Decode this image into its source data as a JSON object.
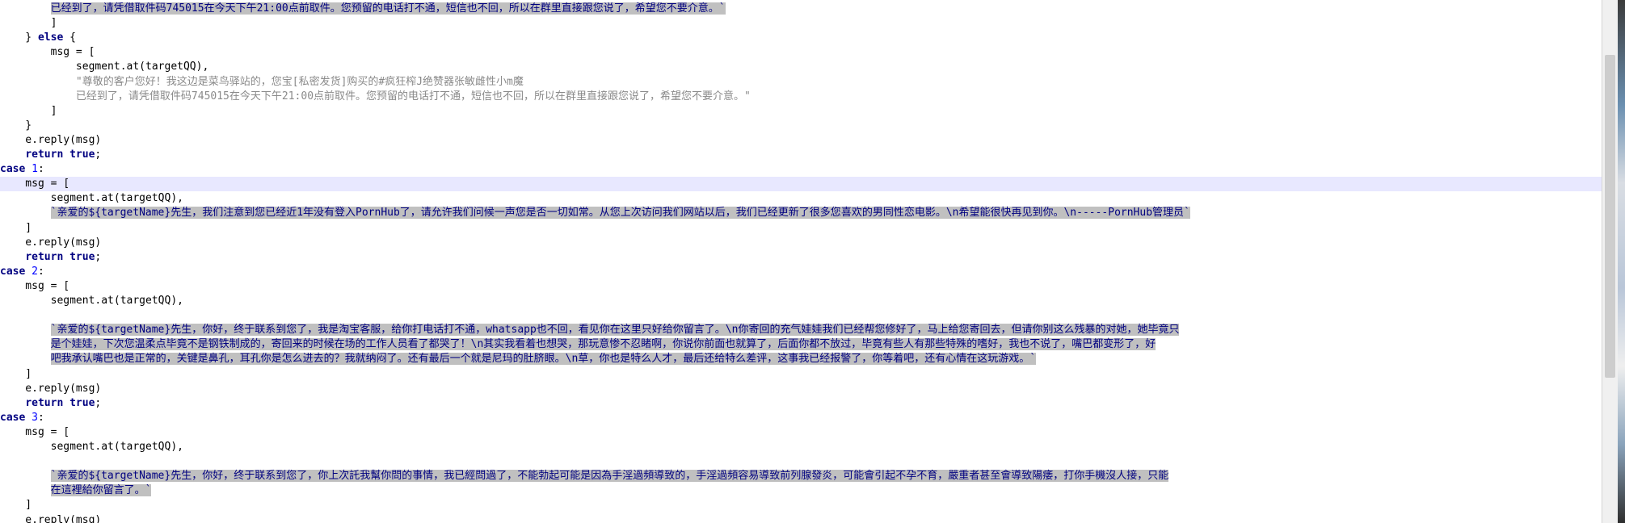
{
  "editor": {
    "lines": [
      {
        "segs": [
          {
            "t": "        ",
            "s": "plain"
          },
          {
            "t": "已经到了，请凭借取件码745015在今天下午21:00点前取件。您预留的电话打不通，短信也不回，所以在群里直接跟您说了，希望您不要介意。`",
            "s": "tpl",
            "sel": true
          }
        ]
      },
      {
        "segs": [
          {
            "t": "        ]",
            "s": "plain"
          }
        ]
      },
      {
        "segs": [
          {
            "t": "    } ",
            "s": "plain"
          },
          {
            "t": "else",
            "s": "kw"
          },
          {
            "t": " {",
            "s": "plain"
          }
        ]
      },
      {
        "segs": [
          {
            "t": "        msg = [",
            "s": "plain"
          }
        ]
      },
      {
        "segs": [
          {
            "t": "            segment.at(targetQQ),",
            "s": "plain"
          }
        ]
      },
      {
        "segs": [
          {
            "t": "            ",
            "s": "plain"
          },
          {
            "t": "\"尊敬的客户您好！我这边是菜鸟驿站的，您宝[私密发货]购买的#疯狂榨J绝赞器张敏雌性小m魔",
            "s": "str"
          }
        ]
      },
      {
        "segs": [
          {
            "t": "            ",
            "s": "plain"
          },
          {
            "t": "已经到了，请凭借取件码745015在今天下午21:00点前取件。您预留的电话打不通，短信也不回，所以在群里直接跟您说了，希望您不要介意。\"",
            "s": "str"
          }
        ]
      },
      {
        "segs": [
          {
            "t": "        ]",
            "s": "plain"
          }
        ]
      },
      {
        "segs": [
          {
            "t": "    }",
            "s": "plain"
          }
        ]
      },
      {
        "segs": [
          {
            "t": "    e.reply(msg)",
            "s": "plain"
          }
        ]
      },
      {
        "segs": [
          {
            "t": "    ",
            "s": "plain"
          },
          {
            "t": "return true",
            "s": "kw"
          },
          {
            "t": ";",
            "s": "plain"
          }
        ]
      },
      {
        "segs": [
          {
            "t": "case",
            "s": "kw"
          },
          {
            "t": " ",
            "s": "plain"
          },
          {
            "t": "1",
            "s": "num"
          },
          {
            "t": ":",
            "s": "plain"
          }
        ]
      },
      {
        "cur": true,
        "segs": [
          {
            "t": "    msg = [",
            "s": "plain"
          }
        ]
      },
      {
        "segs": [
          {
            "t": "        segment.at(targetQQ),",
            "s": "plain"
          }
        ]
      },
      {
        "segs": [
          {
            "t": "        ",
            "s": "plain"
          },
          {
            "t": "`亲爱的${targetName}先生，我们注意到您已经近1年没有登入PornHub了，请允许我们问候一声您是否一切如常。从您上次访问我们网站以后，我们已经更新了很多您喜欢的男同性恋电影。\\n希望能很快再见到你。\\n-----PornHub管理员`",
            "s": "tpl",
            "sel": true
          }
        ]
      },
      {
        "segs": [
          {
            "t": "    ]",
            "s": "plain"
          }
        ]
      },
      {
        "segs": [
          {
            "t": "    e.reply(msg)",
            "s": "plain"
          }
        ]
      },
      {
        "segs": [
          {
            "t": "    ",
            "s": "plain"
          },
          {
            "t": "return true",
            "s": "kw"
          },
          {
            "t": ";",
            "s": "plain"
          }
        ]
      },
      {
        "segs": [
          {
            "t": "case",
            "s": "kw"
          },
          {
            "t": " ",
            "s": "plain"
          },
          {
            "t": "2",
            "s": "num"
          },
          {
            "t": ":",
            "s": "plain"
          }
        ]
      },
      {
        "segs": [
          {
            "t": "    msg = [",
            "s": "plain"
          }
        ]
      },
      {
        "segs": [
          {
            "t": "        segment.at(targetQQ),",
            "s": "plain"
          }
        ]
      },
      {
        "segs": [
          {
            "t": "",
            "s": "plain"
          }
        ]
      },
      {
        "segs": [
          {
            "t": "        ",
            "s": "plain"
          },
          {
            "t": "`亲爱的${targetName}先生，你好，终于联系到您了，我是淘宝客服，给你打电话打不通，whatsapp也不回，看见你在这里只好给你留言了。\\n你寄回的充气娃娃我们已经帮您修好了，马上给您寄回去，但请你别这么残暴的对她，她毕竟只",
            "s": "tpl",
            "sel": true
          }
        ]
      },
      {
        "segs": [
          {
            "t": "        ",
            "s": "plain"
          },
          {
            "t": "是个娃娃，下次您温柔点毕竟不是钢铁制成的，寄回来的时候在场的工作人员看了都哭了！\\n其实我看着也想哭，那玩意惨不忍睹啊，你说你前面也就算了，后面你都不放过，毕竟有些人有那些特殊的嗜好，我也不说了，嘴巴都变形了，好",
            "s": "tpl",
            "sel": true
          }
        ]
      },
      {
        "segs": [
          {
            "t": "        ",
            "s": "plain"
          },
          {
            "t": "吧我承认嘴巴也是正常的，关键是鼻孔，耳孔你是怎么进去的？我就纳闷了。还有最后一个就是尼玛的肚脐眼。\\n草，你也是特么人才，最后还给特么差评，这事我已经报警了，你等着吧，还有心情在这玩游戏。`",
            "s": "tpl",
            "sel": true
          }
        ]
      },
      {
        "segs": [
          {
            "t": "    ]",
            "s": "plain"
          }
        ]
      },
      {
        "segs": [
          {
            "t": "    e.reply(msg)",
            "s": "plain"
          }
        ]
      },
      {
        "segs": [
          {
            "t": "    ",
            "s": "plain"
          },
          {
            "t": "return true",
            "s": "kw"
          },
          {
            "t": ";",
            "s": "plain"
          }
        ]
      },
      {
        "segs": [
          {
            "t": "case",
            "s": "kw"
          },
          {
            "t": " ",
            "s": "plain"
          },
          {
            "t": "3",
            "s": "num"
          },
          {
            "t": ":",
            "s": "plain"
          }
        ]
      },
      {
        "segs": [
          {
            "t": "    msg = [",
            "s": "plain"
          }
        ]
      },
      {
        "segs": [
          {
            "t": "        segment.at(targetQQ),",
            "s": "plain"
          }
        ]
      },
      {
        "segs": [
          {
            "t": "",
            "s": "plain"
          }
        ]
      },
      {
        "segs": [
          {
            "t": "        ",
            "s": "plain"
          },
          {
            "t": "`亲爱的${targetName}先生，你好，终于联系到您了，你上次託我幫你問的事情，我已經問過了，不能勃起可能是因為手淫過頻導致的，手淫過頻容易導致前列腺發炎，可能會引起不孕不育，嚴重者甚至會導致陽痿，打你手機沒人接，只能",
            "s": "tpl",
            "sel": true
          }
        ]
      },
      {
        "segs": [
          {
            "t": "        ",
            "s": "plain"
          },
          {
            "t": "在這裡給你留言了。`",
            "s": "tpl",
            "sel": true
          }
        ]
      },
      {
        "segs": [
          {
            "t": "    ]",
            "s": "plain"
          }
        ]
      },
      {
        "segs": [
          {
            "t": "    e.reply(msg)",
            "s": "plain"
          }
        ]
      }
    ]
  }
}
